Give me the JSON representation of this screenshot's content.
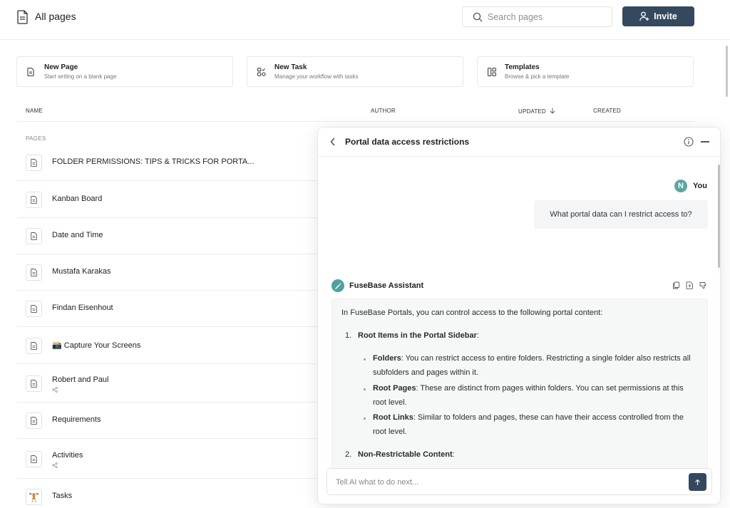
{
  "header": {
    "title": "All pages",
    "search_placeholder": "Search pages",
    "invite_label": "Invite"
  },
  "cards": [
    {
      "title": "New Page",
      "subtitle": "Start writing on a blank page",
      "icon": "document-icon"
    },
    {
      "title": "New Task",
      "subtitle": "Manage your workflow with tasks",
      "icon": "tasks-icon"
    },
    {
      "title": "Templates",
      "subtitle": "Browse & pick a template",
      "icon": "templates-icon"
    }
  ],
  "table": {
    "columns": {
      "name": "NAME",
      "author": "AUTHOR",
      "updated": "UPDATED",
      "created": "CREATED"
    },
    "section_label": "PAGES",
    "rows": [
      {
        "name": "FOLDER PERMISSIONS: TIPS & TRICKS FOR PORTA...",
        "sub": ""
      },
      {
        "name": "Kanban Board",
        "sub": ""
      },
      {
        "name": "Date and Time",
        "sub": ""
      },
      {
        "name": "Mustafa Karakas",
        "sub": ""
      },
      {
        "name": "Findan Eisenhout",
        "sub": ""
      },
      {
        "name": "📸 Capture Your Screens",
        "sub": ""
      },
      {
        "name": "Robert and Paul",
        "sub": "share-icon"
      },
      {
        "name": "Requirements",
        "sub": ""
      },
      {
        "name": "Activities",
        "sub": "share-icon"
      },
      {
        "name": "Tasks",
        "sub": ""
      }
    ]
  },
  "chat": {
    "title": "Portal data access restrictions",
    "user_initial": "N",
    "user_label": "You",
    "user_message": "What portal data can I restrict access to?",
    "assistant_label": "FuseBase Assistant",
    "answer": {
      "intro": "In FuseBase Portals, you can control access to the following portal content:",
      "item1_num": "1.",
      "item1_title": "Root Items in the Portal Sidebar",
      "item1_colon": ":",
      "bullets": [
        {
          "label": "Folders",
          "text": ": You can restrict access to entire folders. Restricting a single folder also restricts all subfolders and pages within it."
        },
        {
          "label": "Root Pages",
          "text": ": These are distinct from pages within folders. You can set permissions at this root level."
        },
        {
          "label": "Root Links",
          "text": ": Similar to folders and pages, these can have their access controlled from the root level."
        }
      ],
      "item2_num": "2.",
      "item2_title": "Non-Restrictable Content",
      "item2_colon": ":"
    },
    "composer_placeholder": "Tell AI what to do next..."
  },
  "colors": {
    "primary": "#34495e",
    "avatar_teal": "#5aa7a3"
  }
}
